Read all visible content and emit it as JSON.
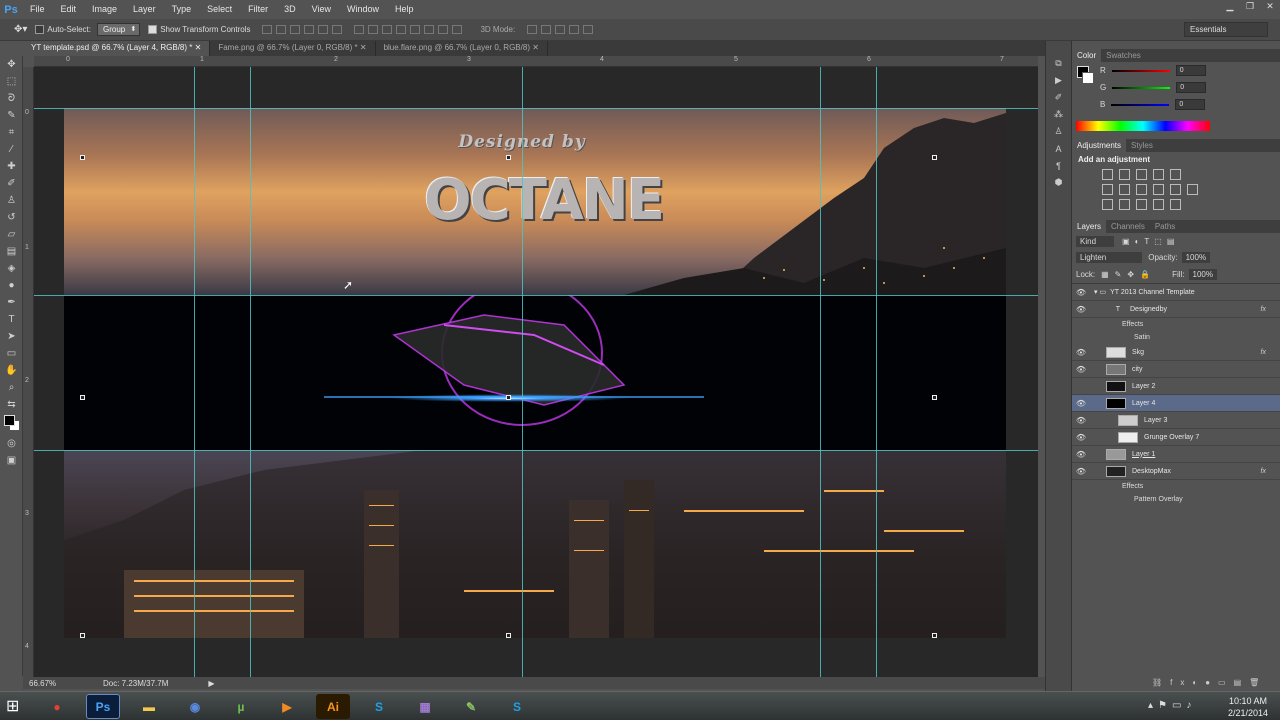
{
  "app": {
    "logo": "Ps"
  },
  "menu": [
    "File",
    "Edit",
    "Image",
    "Layer",
    "Type",
    "Select",
    "Filter",
    "3D",
    "View",
    "Window",
    "Help"
  ],
  "options": {
    "auto_select_label": "Auto-Select:",
    "auto_select_value": "Group",
    "show_transform_label": "Show Transform Controls",
    "mode_label": "3D Mode:",
    "workspace": "Essentials"
  },
  "tabs": [
    {
      "label": "YT template.psd @ 66.7% (Layer 4, RGB/8) *"
    },
    {
      "label": "Fame.png @ 66.7% (Layer 0, RGB/8) *"
    },
    {
      "label": "blue.flare.png @ 66.7% (Layer 0, RGB/8)"
    }
  ],
  "ruler": {
    "top": [
      "0",
      "1",
      "2",
      "3",
      "4",
      "5",
      "6",
      "7"
    ],
    "left": [
      "0",
      "1",
      "2",
      "3",
      "4"
    ]
  },
  "artwork": {
    "line1": "Designed by",
    "line2": "OCTANE"
  },
  "status": {
    "zoom": "66.67%",
    "doc": "Doc: 7.23M/37.7M"
  },
  "color_panel": {
    "tabs": [
      "Color",
      "Swatches"
    ],
    "r_label": "R",
    "g_label": "G",
    "b_label": "B",
    "r": "0",
    "g": "0",
    "b": "0"
  },
  "adjustments_panel": {
    "tabs": [
      "Adjustments",
      "Styles"
    ],
    "title": "Add an adjustment"
  },
  "layers_panel": {
    "tabs": [
      "Layers",
      "Channels",
      "Paths"
    ],
    "kind": "Kind",
    "blend": "Lighten",
    "opacity_label": "Opacity:",
    "opacity": "100%",
    "lock_label": "Lock:",
    "fill_label": "Fill:",
    "fill": "100%",
    "group": "YT 2013 Channel Template",
    "layers": [
      {
        "name": "Designedby",
        "fx": "fx",
        "effects": "Effects",
        "effect": "Satin"
      },
      {
        "name": "Skg",
        "fx": "fx"
      },
      {
        "name": "city"
      },
      {
        "name": "Layer 2"
      },
      {
        "name": "Layer 4"
      },
      {
        "name": "Layer 3"
      },
      {
        "name": "Grunge Overlay 7"
      },
      {
        "name": "Layer 1"
      },
      {
        "name": "DesktopMax",
        "fx": "fx",
        "effects": "Effects",
        "effect": "Pattern Overlay"
      }
    ]
  },
  "taskbar": {
    "apps": [
      "Chrome",
      "Ps",
      "Folder",
      "Cinema",
      "uTorrent",
      "Media",
      "Ai",
      "Skype",
      "Game",
      "Tool",
      "Skype"
    ],
    "time": "10:10 AM",
    "date": "2/21/2014"
  },
  "colors": {
    "guide": "#4fc3c3",
    "accent": "#4aa3f5",
    "flare": "#3fa0ff",
    "purple": "#c238e8"
  }
}
